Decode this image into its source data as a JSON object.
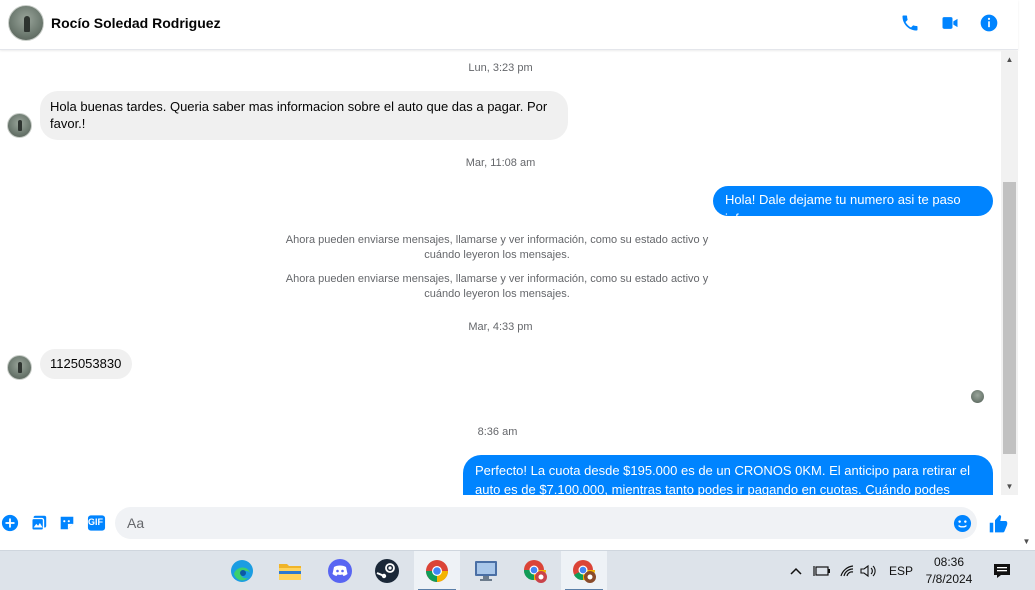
{
  "header": {
    "contact_name": "Rocío Soledad Rodriguez",
    "icons": [
      "phone-icon",
      "video-icon",
      "info-icon"
    ],
    "accent": "#0084ff"
  },
  "conversation": {
    "items": [
      {
        "kind": "timestamp",
        "text": "Lun, 3:23 pm"
      },
      {
        "kind": "incoming",
        "text": "Hola buenas tardes. Queria saber mas informacion sobre el auto que das a pagar. Por favor.!"
      },
      {
        "kind": "timestamp",
        "text": "Mar, 11:08 am"
      },
      {
        "kind": "outgoing",
        "text": "Hola! Dale dejame tu numero  asi te paso info."
      },
      {
        "kind": "notice",
        "text": "Ahora pueden enviarse mensajes, llamarse y ver información, como su estado activo y cuándo leyeron los mensajes."
      },
      {
        "kind": "notice",
        "text": "Ahora pueden enviarse mensajes, llamarse y ver información, como su estado activo y cuándo leyeron los mensajes."
      },
      {
        "kind": "timestamp",
        "text": "Mar, 4:33 pm"
      },
      {
        "kind": "incoming",
        "text": "1125053830"
      },
      {
        "kind": "timestamp",
        "text": "8:36 am"
      },
      {
        "kind": "outgoing",
        "text": "Perfecto! La cuota desde $195.000 es de un CRONOS 0KM. El anticipo para retirar el auto es de $7.100.000, mientras tanto podes ir pagando en cuotas. Cuándo podes hablar? A la"
      }
    ]
  },
  "composer": {
    "placeholder": "Aa",
    "icons": [
      "add-icon",
      "photo-icon",
      "sticker-icon",
      "gif-icon",
      "emoji-icon",
      "like-icon"
    ],
    "gif_label": "GIF"
  },
  "taskbar": {
    "apps": [
      "edge-icon",
      "file-explorer-icon",
      "discord-icon",
      "steam-icon",
      "chrome-icon",
      "monitor-app-icon",
      "chrome-profile-icon",
      "chrome-profile-icon"
    ],
    "language": "ESP",
    "time": "08:36",
    "date": "7/8/2024"
  }
}
